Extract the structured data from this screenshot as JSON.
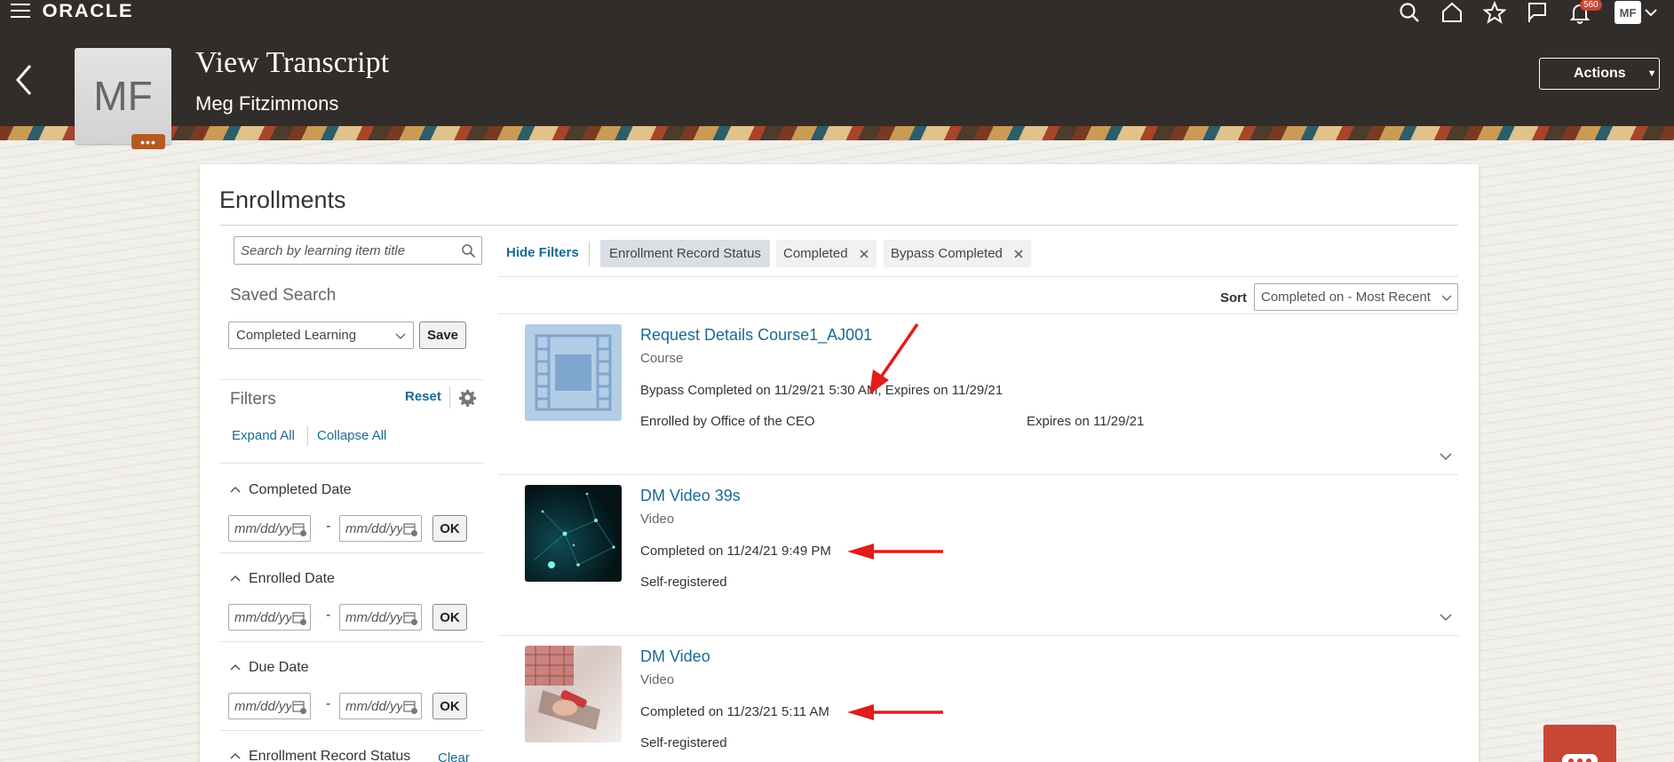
{
  "header": {
    "brand": "ORACLE",
    "notification_count": "560",
    "user_initials": "MF",
    "page_title": "View Transcript",
    "person_name": "Meg Fitzimmons",
    "profile_initials": "MF",
    "profile_more": "•••",
    "actions_label": "Actions",
    "actions_caret": "▼"
  },
  "card": {
    "title": "Enrollments"
  },
  "filters_panel": {
    "search_placeholder": "Search by learning item title",
    "saved_search_label": "Saved Search",
    "saved_search_value": "Completed Learning",
    "save_label": "Save",
    "filters_label": "Filters",
    "reset_label": "Reset",
    "expand_all": "Expand All",
    "collapse_all": "Collapse All",
    "date_placeholder": "mm/dd/yy",
    "dash": "-",
    "ok_label": "OK",
    "groups": [
      {
        "title": "Completed Date"
      },
      {
        "title": "Enrolled Date"
      },
      {
        "title": "Due Date"
      },
      {
        "title": "Enrollment Record Status",
        "clear": "Clear"
      }
    ]
  },
  "chips": {
    "hide_filters": "Hide Filters",
    "status_label": "Enrollment Record Status",
    "values": [
      "Completed",
      "Bypass Completed"
    ]
  },
  "sort": {
    "label": "Sort",
    "value": "Completed on - Most Recent"
  },
  "items": [
    {
      "title": "Request Details Course1_AJ001",
      "type": "Course",
      "status": "Bypass Completed on 11/29/21 5:30 AM, Expires on 11/29/21",
      "enrolled": "Enrolled by Office of the CEO",
      "expires": "Expires on 11/29/21"
    },
    {
      "title": "DM Video 39s",
      "type": "Video",
      "status": "Completed on 11/24/21 9:49 PM",
      "enrolled": "Self-registered"
    },
    {
      "title": "DM Video",
      "type": "Video",
      "status": "Completed on 11/23/21 5:11 AM",
      "enrolled": "Self-registered"
    }
  ],
  "colors": {
    "topbar": "#312d2a",
    "link": "#1a6a94",
    "accent_orange": "#b55a22",
    "annotation_red": "#e21b1b",
    "chat_red": "#c74634"
  },
  "icons": [
    "menu-icon",
    "search-icon",
    "home-icon",
    "star-icon",
    "flag-icon",
    "bell-icon",
    "chevron-down-icon",
    "back-arrow-icon",
    "gear-icon",
    "calendar-icon",
    "close-icon",
    "chat-icon"
  ]
}
